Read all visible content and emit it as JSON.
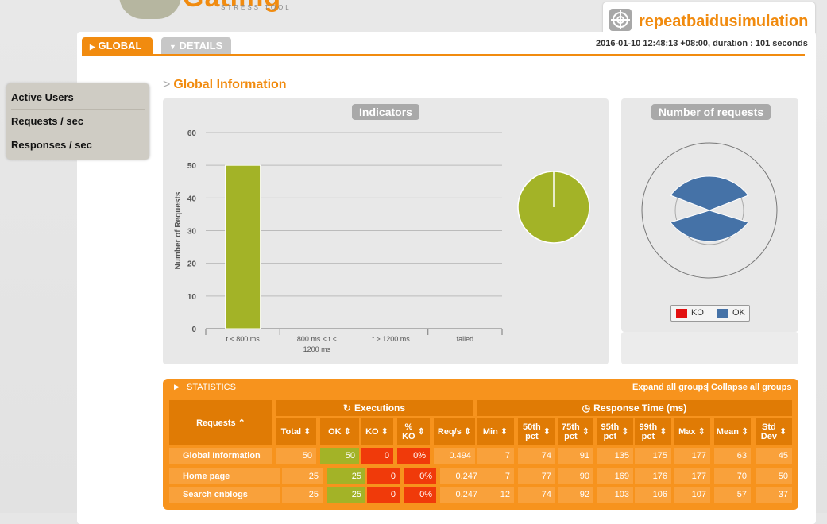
{
  "header": {
    "logo_word": "Gatling",
    "logo_sub": "STRESS TOOL",
    "simulation_name": "repeatbaidusimulation",
    "run_info": "2016-01-10 12:48:13 +08:00, duration : 101 seconds"
  },
  "tabs": [
    {
      "label": "GLOBAL",
      "icon": "triangle-right-icon",
      "active": true
    },
    {
      "label": "DETAILS",
      "icon": "triangle-down-icon",
      "active": false
    }
  ],
  "sidebar": {
    "items": [
      {
        "label": "Active Users"
      },
      {
        "label": "Requests / sec"
      },
      {
        "label": "Responses / sec"
      }
    ]
  },
  "section": {
    "title": "Global Information"
  },
  "indicators": {
    "title": "Indicators",
    "chart_data": {
      "type": "bar",
      "ylabel": "Number of Requests",
      "ylim": [
        0,
        60
      ],
      "yticks": [
        "0",
        "10",
        "20",
        "30",
        "40",
        "50",
        "60"
      ],
      "categories": [
        "t < 800 ms",
        "800 ms < t < 1200 ms",
        "t > 1200 ms",
        "failed"
      ],
      "category_lines": [
        [
          "t < 800 ms"
        ],
        [
          "800 ms < t <",
          "1200 ms"
        ],
        [
          "t > 1200 ms"
        ],
        [
          "failed"
        ]
      ],
      "values": [
        50,
        0,
        0,
        0
      ],
      "bar_color": "#a3b327",
      "pie": {
        "type": "pie",
        "values": [
          50,
          0,
          0,
          0
        ],
        "color": "#a3b327"
      }
    }
  },
  "requests_panel": {
    "title": "Number of requests",
    "legend": [
      {
        "label": "KO",
        "color": "#e21010"
      },
      {
        "label": "OK",
        "color": "#4572a7"
      }
    ]
  },
  "statistics": {
    "title": "STATISTICS",
    "expand_label": "Expand all groups",
    "separator": "|",
    "collapse_label": "Collapse all groups",
    "requests_header": "Requests",
    "executions_header": "Executions",
    "response_time_header": "Response Time (ms)",
    "columns": [
      [
        "Total"
      ],
      [
        "OK"
      ],
      [
        "KO"
      ],
      [
        "%",
        "KO"
      ],
      [
        "Req/s"
      ],
      [
        "Min"
      ],
      [
        "50th",
        "pct"
      ],
      [
        "75th",
        "pct"
      ],
      [
        "95th",
        "pct"
      ],
      [
        "99th",
        "pct"
      ],
      [
        "Max"
      ],
      [
        "Mean"
      ],
      [
        "Std",
        "Dev"
      ]
    ],
    "rows": [
      {
        "name": "Global Information",
        "values": [
          "50",
          "50",
          "0",
          "0%",
          "0.494",
          "7",
          "74",
          "91",
          "135",
          "175",
          "177",
          "63",
          "45"
        ]
      },
      {
        "name": "Home page",
        "values": [
          "25",
          "25",
          "0",
          "0%",
          "0.247",
          "7",
          "77",
          "90",
          "169",
          "176",
          "177",
          "70",
          "50"
        ]
      },
      {
        "name": "Search cnblogs",
        "values": [
          "25",
          "25",
          "0",
          "0%",
          "0.247",
          "12",
          "74",
          "92",
          "103",
          "106",
          "107",
          "57",
          "37"
        ]
      }
    ]
  }
}
